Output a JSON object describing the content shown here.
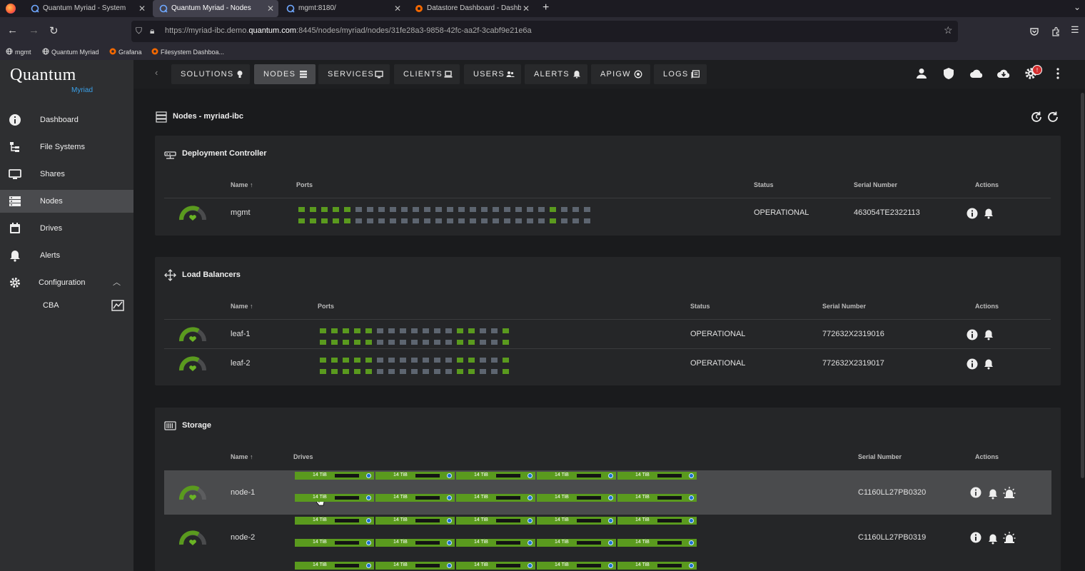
{
  "browser": {
    "tabs": [
      {
        "title": "Quantum Myriad - System",
        "active": false
      },
      {
        "title": "Quantum Myriad - Nodes",
        "active": true
      },
      {
        "title": "mgmt:8180/",
        "active": false
      },
      {
        "title": "Datastore Dashboard - Dashbo",
        "active": false
      }
    ],
    "url_prefix": "https://myriad-ibc.demo.",
    "url_domain": "quantum.com",
    "url_suffix": ":8445/nodes/myriad/nodes/31fe28a3-9858-42fc-aa2f-3cabf9e21e6a",
    "bookmarks": [
      "mgmt",
      "Quantum Myriad",
      "Grafana",
      "Filesystem Dashboa..."
    ]
  },
  "sidebar": {
    "logo": "Quantum",
    "logo_sub": "Myriad",
    "items": [
      {
        "label": "Dashboard",
        "icon": "info-icon"
      },
      {
        "label": "File Systems",
        "icon": "tree-icon"
      },
      {
        "label": "Shares",
        "icon": "monitor-icon"
      },
      {
        "label": "Nodes",
        "icon": "server-icon",
        "active": true
      },
      {
        "label": "Drives",
        "icon": "calendar-icon"
      },
      {
        "label": "Alerts",
        "icon": "bell-icon"
      },
      {
        "label": "Configuration",
        "icon": "gear-icon",
        "expanded": true
      }
    ],
    "sub_items": [
      {
        "label": "CBA",
        "icon": "chart-icon"
      }
    ]
  },
  "appbar": {
    "nav": [
      {
        "label": "SOLUTIONS",
        "icon": "lightbulb-icon"
      },
      {
        "label": "NODES",
        "icon": "list-icon",
        "active": true
      },
      {
        "label": "SERVICES",
        "icon": "monitor-icon"
      },
      {
        "label": "CLIENTS",
        "icon": "laptop-icon"
      },
      {
        "label": "USERS",
        "icon": "users-icon"
      },
      {
        "label": "ALERTS",
        "icon": "bell-icon"
      },
      {
        "label": "APIGW",
        "icon": "target-icon"
      },
      {
        "label": "LOGS",
        "icon": "logs-icon"
      }
    ],
    "notification_badge": "!"
  },
  "page": {
    "title": "Nodes - myriad-ibc"
  },
  "deployment_controller": {
    "title": "Deployment Controller",
    "headers": {
      "name": "Name",
      "ports": "Ports",
      "status": "Status",
      "serial": "Serial Number",
      "actions": "Actions"
    },
    "rows": [
      {
        "name": "mgmt",
        "status": "OPERATIONAL",
        "serial": "463054TE2322113",
        "ports_top": [
          1,
          1,
          1,
          1,
          1,
          0,
          0,
          0,
          0,
          0,
          0,
          0,
          0,
          0,
          0,
          0,
          0,
          0,
          0,
          0,
          0,
          0,
          1,
          0,
          0,
          0
        ],
        "ports_bottom": [
          1,
          1,
          1,
          1,
          1,
          0,
          0,
          0,
          0,
          0,
          0,
          0,
          0,
          0,
          0,
          0,
          0,
          0,
          0,
          0,
          0,
          0,
          1,
          0,
          0,
          0
        ]
      }
    ]
  },
  "load_balancers": {
    "title": "Load Balancers",
    "headers": {
      "name": "Name",
      "ports": "Ports",
      "status": "Status",
      "serial": "Serial Number",
      "actions": "Actions"
    },
    "rows": [
      {
        "name": "leaf-1",
        "status": "OPERATIONAL",
        "serial": "772632X2319016",
        "ports_top": [
          1,
          1,
          1,
          1,
          1,
          0,
          0,
          0,
          0,
          0,
          0,
          0,
          1,
          1,
          0,
          0,
          1
        ],
        "ports_bottom": [
          1,
          1,
          1,
          1,
          1,
          0,
          0,
          0,
          0,
          0,
          0,
          0,
          1,
          1,
          0,
          0,
          1
        ]
      },
      {
        "name": "leaf-2",
        "status": "OPERATIONAL",
        "serial": "772632X2319017",
        "ports_top": [
          1,
          1,
          1,
          1,
          1,
          0,
          0,
          0,
          0,
          0,
          0,
          0,
          1,
          1,
          0,
          0,
          1
        ],
        "ports_bottom": [
          1,
          1,
          1,
          1,
          1,
          0,
          0,
          0,
          0,
          0,
          0,
          0,
          1,
          1,
          0,
          0,
          1
        ]
      }
    ]
  },
  "storage": {
    "title": "Storage",
    "headers": {
      "name": "Name",
      "drives": "Drives",
      "serial": "Serial Number",
      "actions": "Actions"
    },
    "drive_label": "14 TiB",
    "rows": [
      {
        "name": "node-1",
        "serial": "C1160LL27PB0320"
      },
      {
        "name": "node-2",
        "serial": "C1160LL27PB0319"
      },
      {
        "name": "",
        "serial": ""
      }
    ]
  },
  "colors": {
    "accent_green": "#5a9a1e",
    "port_inactive": "#5d6570",
    "drive_led": "#1c6fd1"
  }
}
